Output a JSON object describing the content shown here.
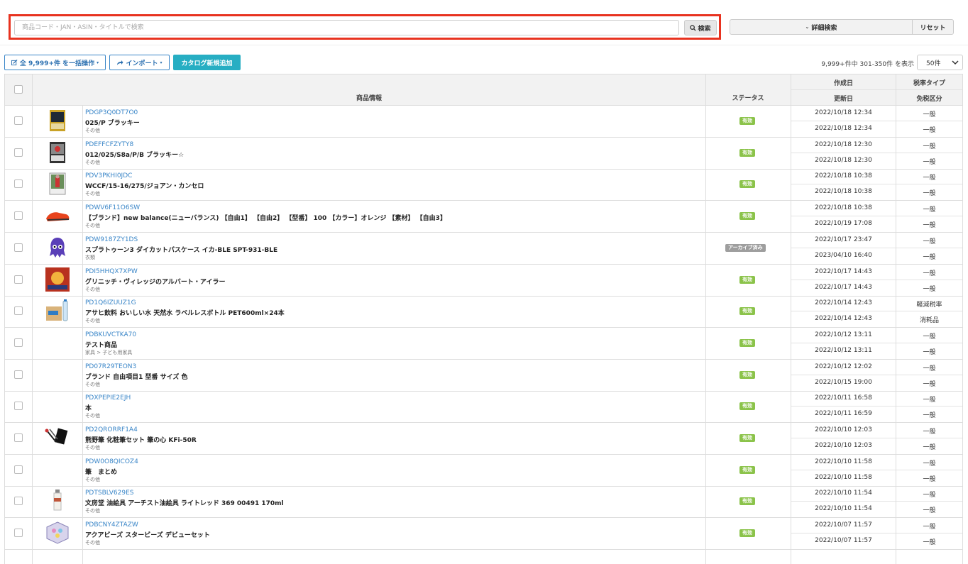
{
  "search": {
    "placeholder": "商品コード・JAN・ASIN・タイトルで検索",
    "button_label": "検索",
    "advanced_label": "詳細検索",
    "reset_label": "リセット"
  },
  "toolbar": {
    "bulk_label": "全 9,999+件 を一括操作",
    "import_label": "インポート",
    "add_label": "カタログ新規追加",
    "range_text": "9,999+件中 301-350件 を表示",
    "per_page": "50件"
  },
  "colors": {
    "accent": "#27aec3",
    "link": "#3a86c8",
    "active": "#8bc34a",
    "archived": "#9e9e9e",
    "highlight": "#e8321f"
  },
  "table": {
    "headers": {
      "product": "商品情報",
      "status": "ステータス",
      "created": "作成日",
      "updated": "更新日",
      "tax_type": "税率タイプ",
      "duty": "免税区分"
    },
    "rows": [
      {
        "code": "PDGP3Q0DT7O0",
        "title": "025/P ブラッキー",
        "category": "その他",
        "status": "有効",
        "created": "2022/10/18 12:34",
        "updated": "2022/10/18 12:34",
        "tax": "一般",
        "duty": "一般",
        "icon": "trading-card"
      },
      {
        "code": "PDEFFCFZYTY8",
        "title": "012/025/S8a/P/B ブラッキー☆",
        "category": "その他",
        "status": "有効",
        "created": "2022/10/18 12:30",
        "updated": "2022/10/18 12:30",
        "tax": "一般",
        "duty": "一般",
        "icon": "trading-card-dark"
      },
      {
        "code": "PDV3PKHI0JDC",
        "title": "WCCF/15-16/275/ジョアン・カンセロ",
        "category": "その他",
        "status": "有効",
        "created": "2022/10/18 10:38",
        "updated": "2022/10/18 10:38",
        "tax": "一般",
        "duty": "一般",
        "icon": "football-card"
      },
      {
        "code": "PDWV6F11O6SW",
        "title": "【ブランド】new balance(ニューバランス) 【自由1】 【自由2】 【型番】 100 【カラー】オレンジ 【素材】 【自由3】",
        "category": "その他",
        "status": "有効",
        "created": "2022/10/18 10:38",
        "updated": "2022/10/19 17:08",
        "tax": "一般",
        "duty": "一般",
        "icon": "shoe"
      },
      {
        "code": "PDW9187ZY1DS",
        "title": "スプラトゥーン3 ダイカットパスケース イカ-BLE SPT-931-BLE",
        "category": "衣類",
        "status": "アーカイブ済み",
        "created": "2022/10/17 23:47",
        "updated": "2023/04/10 16:40",
        "tax": "一般",
        "duty": "一般",
        "icon": "squid"
      },
      {
        "code": "PDI5HHQX7XPW",
        "title": "グリニッチ・ヴィレッジのアルバート・アイラー",
        "category": "その他",
        "status": "有効",
        "created": "2022/10/17 14:43",
        "updated": "2022/10/17 14:43",
        "tax": "一般",
        "duty": "一般",
        "icon": "album"
      },
      {
        "code": "PD1Q6IZUUZ1G",
        "title": "アサヒ飲料 おいしい水 天然水 ラベルレスボトル PET600ml×24本",
        "category": "その他",
        "status": "有効",
        "created": "2022/10/14 12:43",
        "updated": "2022/10/14 12:43",
        "tax": "軽減税率",
        "duty": "消耗品",
        "icon": "water-box"
      },
      {
        "code": "PDBKUVCTKA70",
        "title": "テスト商品",
        "category": "家具 > 子ども用家具",
        "status": "有効",
        "created": "2022/10/12 13:11",
        "updated": "2022/10/12 13:11",
        "tax": "一般",
        "duty": "一般",
        "icon": ""
      },
      {
        "code": "PD07R29TEON3",
        "title": "ブランド 自由項目1 型番 サイズ 色",
        "category": "その他",
        "status": "有効",
        "created": "2022/10/12 12:02",
        "updated": "2022/10/15 19:00",
        "tax": "一般",
        "duty": "一般",
        "icon": ""
      },
      {
        "code": "PDXPEPIE2EJH",
        "title": "本",
        "category": "その他",
        "status": "有効",
        "created": "2022/10/11 16:58",
        "updated": "2022/10/11 16:59",
        "tax": "一般",
        "duty": "一般",
        "icon": ""
      },
      {
        "code": "PD2QRORRF1A4",
        "title": "熊野筆 化粧筆セット 筆の心 KFi-50R",
        "category": "その他",
        "status": "有効",
        "created": "2022/10/10 12:03",
        "updated": "2022/10/10 12:03",
        "tax": "一般",
        "duty": "一般",
        "icon": "brush-set"
      },
      {
        "code": "PDW0O8QICOZ4",
        "title": "筆　まとめ",
        "category": "その他",
        "status": "有効",
        "created": "2022/10/10 11:58",
        "updated": "2022/10/10 11:58",
        "tax": "一般",
        "duty": "一般",
        "icon": ""
      },
      {
        "code": "PDTSBLV629ES",
        "title": "文房堂 油絵具 アーチスト油絵具 ライトレッド 369 00491 170ml",
        "category": "その他",
        "status": "有効",
        "created": "2022/10/10 11:54",
        "updated": "2022/10/10 11:54",
        "tax": "一般",
        "duty": "一般",
        "icon": "paint-tube"
      },
      {
        "code": "PDBCNY4ZTAZW",
        "title": "アクアビーズ スタービーズ デビューセット",
        "category": "その他",
        "status": "有効",
        "created": "2022/10/07 11:57",
        "updated": "2022/10/07 11:57",
        "tax": "一般",
        "duty": "一般",
        "icon": "beads-set"
      }
    ]
  }
}
